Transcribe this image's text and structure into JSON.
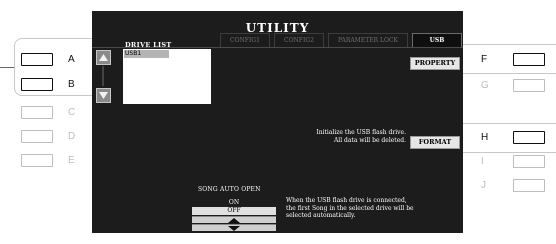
{
  "screen": {
    "title": "UTILITY",
    "tabs": [
      {
        "label": "CONFIG1",
        "active": false
      },
      {
        "label": "CONFIG2",
        "active": false
      },
      {
        "label": "PARAMETER LOCK",
        "active": false
      },
      {
        "label": "USB",
        "active": true
      }
    ]
  },
  "drive_list": {
    "heading": "DRIVE LIST",
    "items": [
      "USB1"
    ],
    "selected": "USB1"
  },
  "property_button": "PROPERTY",
  "format_button": "FORMAT",
  "info_text": {
    "line1": "Initialize the USB flash drive.",
    "line2": "All data will be deleted."
  },
  "song_auto_open": {
    "heading": "SONG AUTO OPEN",
    "options": [
      "ON",
      "OFF"
    ],
    "selected": "OFF",
    "description": [
      "When the USB flash drive is connected,",
      "the first Song in the selected drive will be",
      "selected automatically."
    ]
  },
  "side_buttons": {
    "left": [
      {
        "label": "A",
        "active": true
      },
      {
        "label": "B",
        "active": true
      },
      {
        "label": "C",
        "active": false
      },
      {
        "label": "D",
        "active": false
      },
      {
        "label": "E",
        "active": false
      }
    ],
    "right": [
      {
        "label": "F",
        "active": true
      },
      {
        "label": "G",
        "active": false
      },
      {
        "label": "H",
        "active": true
      },
      {
        "label": "I",
        "active": false
      },
      {
        "label": "J",
        "active": false
      }
    ]
  },
  "colors": {
    "screen_bg": "#1c1c1c",
    "screen_text": "#ffffff",
    "button_bg": "#e6e6e6",
    "inactive_outline": "#bdbdbd"
  }
}
